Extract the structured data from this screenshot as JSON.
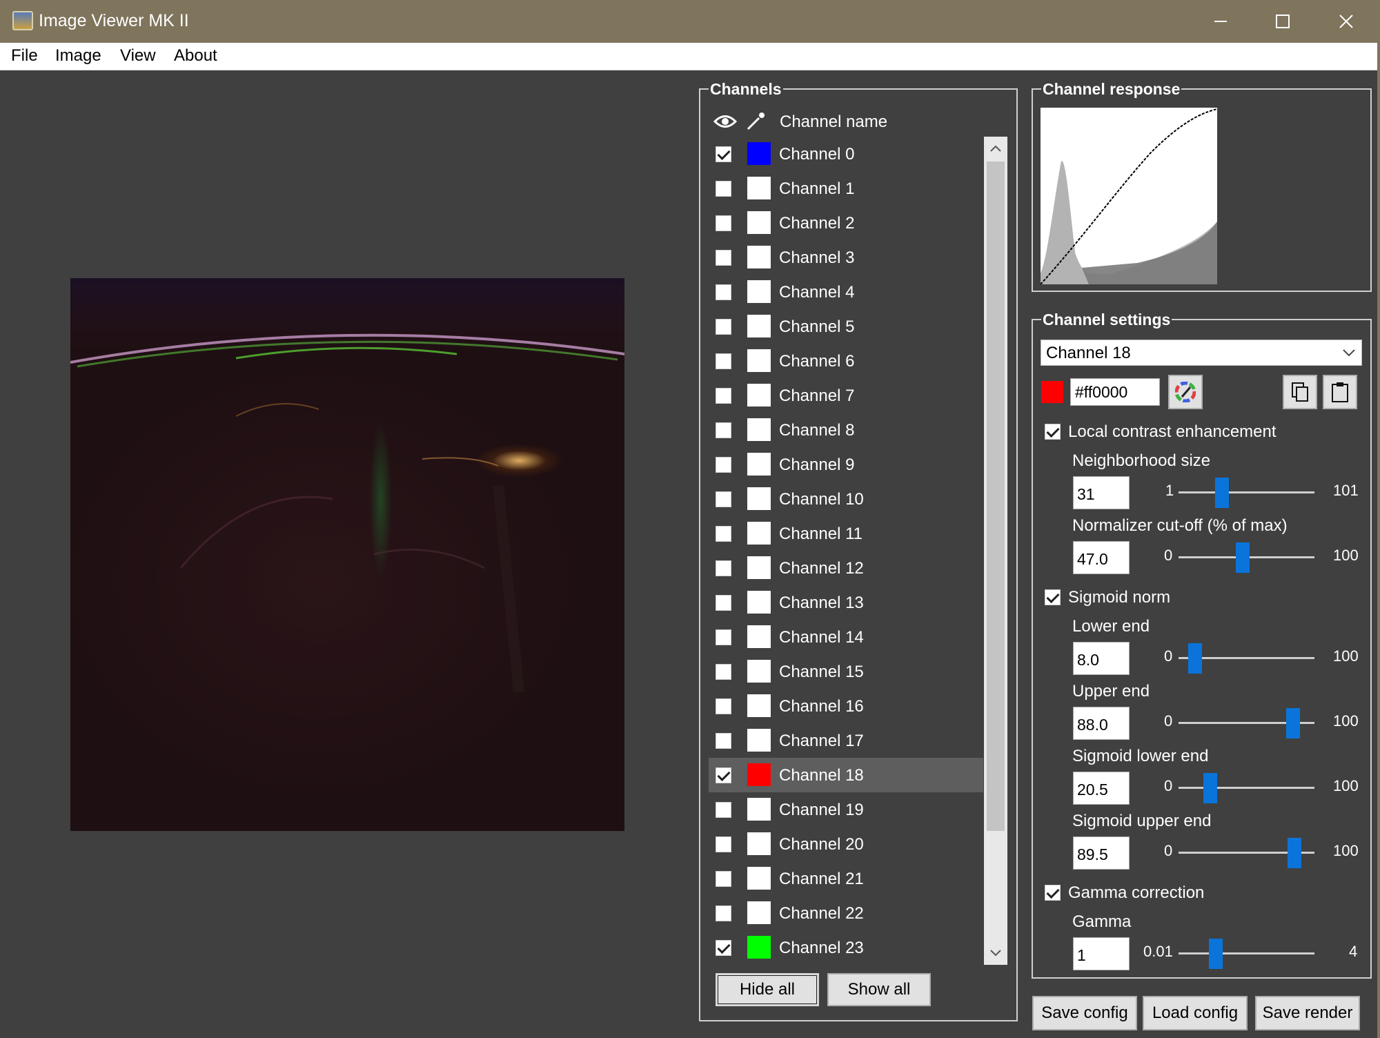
{
  "window": {
    "title": "Image Viewer MK II",
    "controls": [
      "minimize",
      "maximize",
      "close"
    ]
  },
  "menu": [
    "File",
    "Image",
    "View",
    "About"
  ],
  "channels_panel": {
    "title": "Channels",
    "header_label": "Channel name",
    "channels": [
      {
        "label": "Channel 0",
        "checked": true,
        "color": "#0000ff"
      },
      {
        "label": "Channel 1",
        "checked": false,
        "color": "#ffffff"
      },
      {
        "label": "Channel 2",
        "checked": false,
        "color": "#ffffff"
      },
      {
        "label": "Channel 3",
        "checked": false,
        "color": "#ffffff"
      },
      {
        "label": "Channel 4",
        "checked": false,
        "color": "#ffffff"
      },
      {
        "label": "Channel 5",
        "checked": false,
        "color": "#ffffff"
      },
      {
        "label": "Channel 6",
        "checked": false,
        "color": "#ffffff"
      },
      {
        "label": "Channel 7",
        "checked": false,
        "color": "#ffffff"
      },
      {
        "label": "Channel 8",
        "checked": false,
        "color": "#ffffff"
      },
      {
        "label": "Channel 9",
        "checked": false,
        "color": "#ffffff"
      },
      {
        "label": "Channel 10",
        "checked": false,
        "color": "#ffffff"
      },
      {
        "label": "Channel 11",
        "checked": false,
        "color": "#ffffff"
      },
      {
        "label": "Channel 12",
        "checked": false,
        "color": "#ffffff"
      },
      {
        "label": "Channel 13",
        "checked": false,
        "color": "#ffffff"
      },
      {
        "label": "Channel 14",
        "checked": false,
        "color": "#ffffff"
      },
      {
        "label": "Channel 15",
        "checked": false,
        "color": "#ffffff"
      },
      {
        "label": "Channel 16",
        "checked": false,
        "color": "#ffffff"
      },
      {
        "label": "Channel 17",
        "checked": false,
        "color": "#ffffff"
      },
      {
        "label": "Channel 18",
        "checked": true,
        "color": "#ff0000",
        "selected": true
      },
      {
        "label": "Channel 19",
        "checked": false,
        "color": "#ffffff"
      },
      {
        "label": "Channel 20",
        "checked": false,
        "color": "#ffffff"
      },
      {
        "label": "Channel 21",
        "checked": false,
        "color": "#ffffff"
      },
      {
        "label": "Channel 22",
        "checked": false,
        "color": "#ffffff"
      },
      {
        "label": "Channel 23",
        "checked": true,
        "color": "#00ff00"
      }
    ],
    "hide_all": "Hide all",
    "show_all": "Show all"
  },
  "response_panel": {
    "title": "Channel response"
  },
  "settings": {
    "title": "Channel settings",
    "selected_channel": "Channel 18",
    "color_value": "#ff0000",
    "color_text": "#ff0000",
    "local_contrast": {
      "label": "Local contrast enhancement",
      "checked": true,
      "neighborhood": {
        "label": "Neighborhood size",
        "value": "31",
        "min": "1",
        "max": "101",
        "level": 0.3
      },
      "normalizer": {
        "label": "Normalizer cut-off (% of max)",
        "value": "47.0",
        "min": "0",
        "max": "100",
        "level": 0.47
      }
    },
    "sigmoid": {
      "label": "Sigmoid norm",
      "checked": true,
      "lower": {
        "label": "Lower end",
        "value": "8.0",
        "min": "0",
        "max": "100",
        "level": 0.08
      },
      "upper": {
        "label": "Upper end",
        "value": "88.0",
        "min": "0",
        "max": "100",
        "level": 0.88
      },
      "sig_lower": {
        "label": "Sigmoid lower end",
        "value": "20.5",
        "min": "0",
        "max": "100",
        "level": 0.205
      },
      "sig_upper": {
        "label": "Sigmoid upper end",
        "value": "89.5",
        "min": "0",
        "max": "100",
        "level": 0.895
      }
    },
    "gamma_correction": {
      "label": "Gamma correction",
      "checked": true,
      "gamma": {
        "label": "Gamma",
        "value": "1",
        "min": "0.01",
        "max": "4",
        "level": 0.25
      }
    }
  },
  "footer": {
    "save_config": "Save config",
    "load_config": "Load config",
    "save_render": "Save render"
  },
  "colors": {
    "titlebar": "#7f745c",
    "background": "#404040",
    "slider_thumb": "#0a74da"
  }
}
